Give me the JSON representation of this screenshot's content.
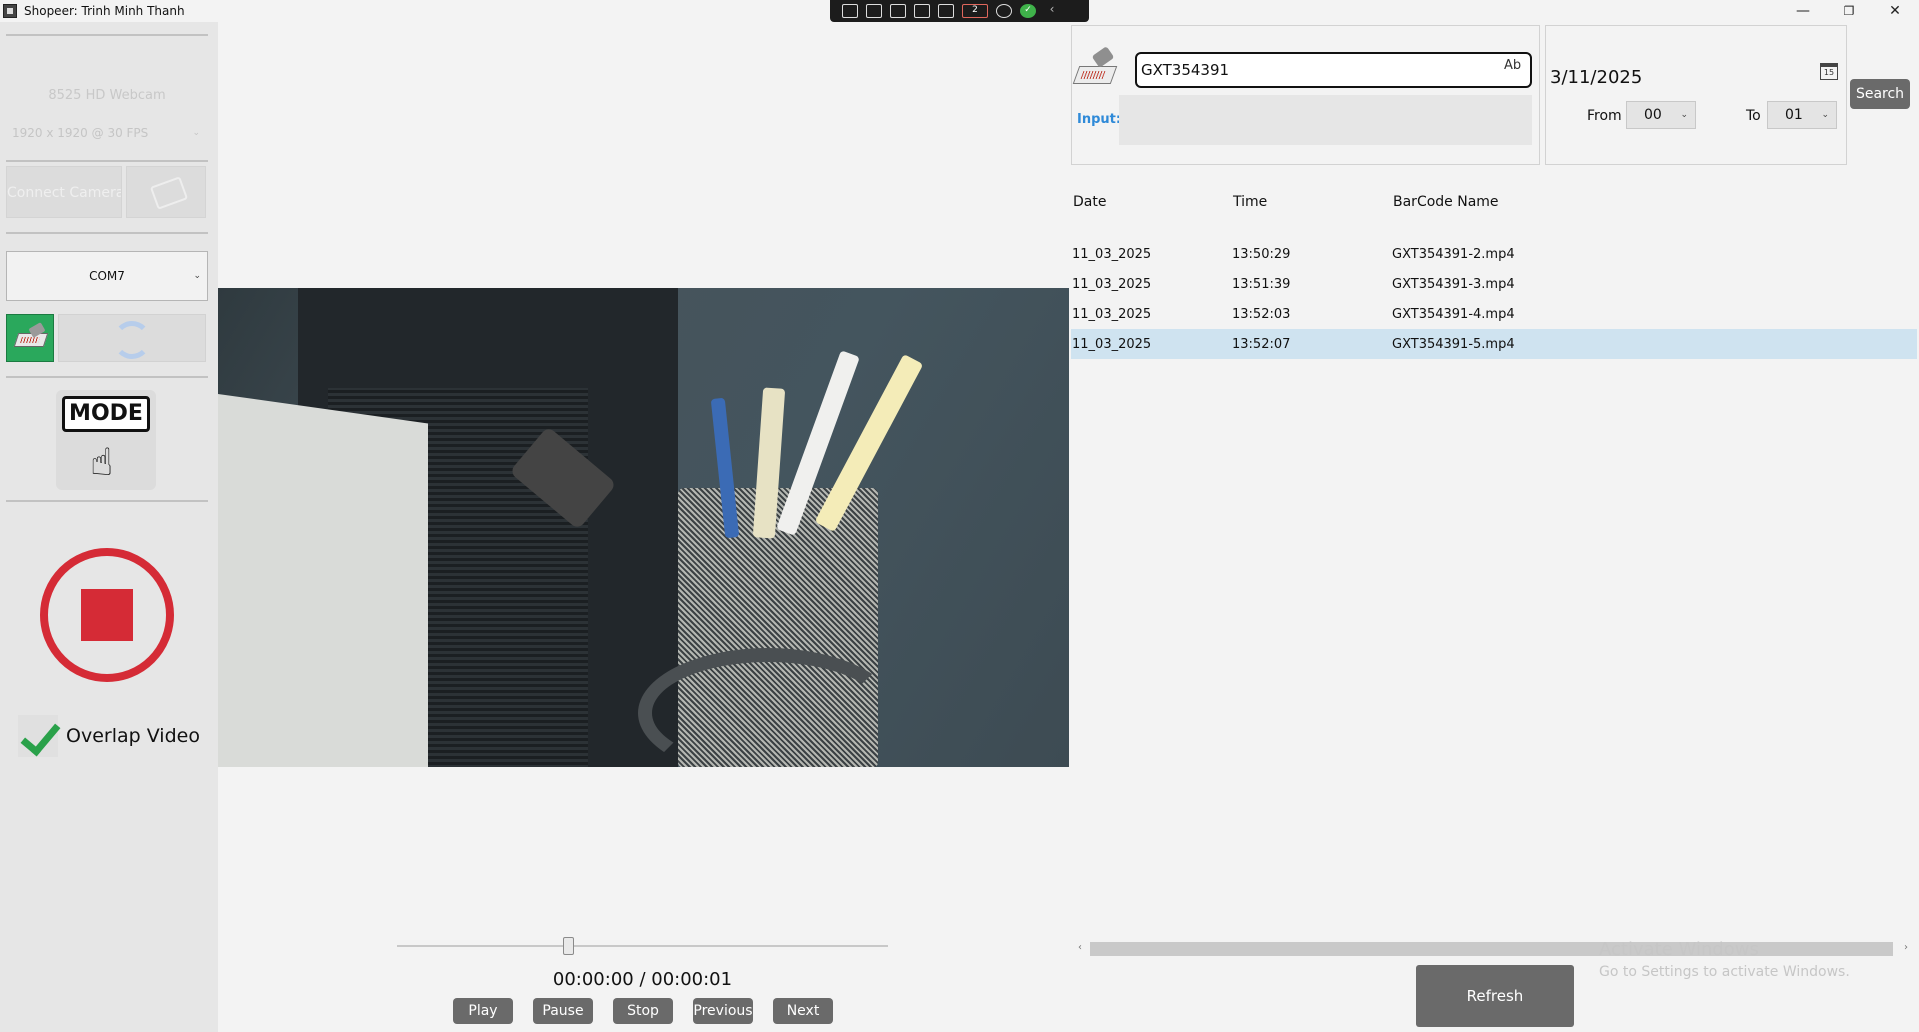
{
  "window": {
    "title": "Shopeer: Trinh Minh Thanh"
  },
  "remote_toolbar": {
    "badge_count": "2"
  },
  "sidebar": {
    "camera_name": "8525 HD Webcam",
    "resolution": "1920 x 1920 @ 30 FPS",
    "connect_label": "Connect Camera",
    "com_port": "COM7",
    "mode_label": "MODE",
    "overlap_label": "Overlap Video",
    "overlap_checked": true
  },
  "player": {
    "timecode": "00:00:00 / 00:00:01",
    "progress": 0.35,
    "buttons": {
      "play": "Play",
      "pause": "Pause",
      "stop": "Stop",
      "previous": "Previous",
      "next": "Next"
    }
  },
  "search": {
    "barcode_value": "GXT354391",
    "input_label": "Input:",
    "input_value": "",
    "date": "3/11/2025",
    "from_label": "From",
    "from_value": "00",
    "to_label": "To",
    "to_value": "01",
    "search_label": "Search"
  },
  "results": {
    "headers": {
      "date": "Date",
      "time": "Time",
      "name": "BarCode Name"
    },
    "rows": [
      {
        "date": "11_03_2025",
        "time": "13:50:29",
        "name": "GXT354391-2.mp4"
      },
      {
        "date": "11_03_2025",
        "time": "13:51:39",
        "name": "GXT354391-3.mp4"
      },
      {
        "date": "11_03_2025",
        "time": "13:52:03",
        "name": "GXT354391-4.mp4"
      },
      {
        "date": "11_03_2025",
        "time": "13:52:07",
        "name": "GXT354391-5.mp4"
      }
    ],
    "selected_index": 3,
    "refresh_label": "Refresh"
  },
  "watermark": {
    "line1": "Activate Windows",
    "line2": "Go to Settings to activate Windows."
  },
  "colors": {
    "record_red": "#d52b36",
    "link_blue": "#2f8ad8",
    "selection": "#cfe3f0",
    "button_gray": "#6a6a6a"
  }
}
